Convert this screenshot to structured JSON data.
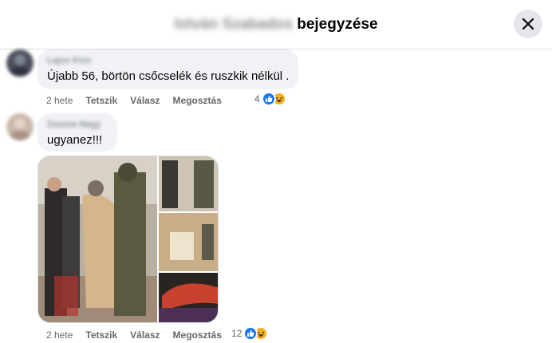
{
  "header": {
    "author_name": "István Szabados",
    "title_suffix": "bejegyzése",
    "close_label": "×"
  },
  "comments": [
    {
      "author": "Lajos Kiss",
      "text": "Újabb 56, börtön csőcselék és ruszkik nélkül .",
      "time": "2 hete",
      "like_label": "Tetszik",
      "reply_label": "Válasz",
      "share_label": "Megosztás",
      "reaction_count": "4"
    },
    {
      "author": "Zsuzsa Nagy",
      "text": "ugyanez!!!",
      "time": "2 hete",
      "like_label": "Tetszik",
      "reply_label": "Válasz",
      "share_label": "Megosztás",
      "reaction_count": "12"
    }
  ],
  "colors": {
    "like_blue": "#1877f2",
    "haha_yellow": "#f7b125",
    "bubble_bg": "#f0f2f5",
    "meta_gray": "#65676b"
  },
  "icons": [
    "close-icon",
    "like-reaction-icon",
    "haha-reaction-icon"
  ]
}
